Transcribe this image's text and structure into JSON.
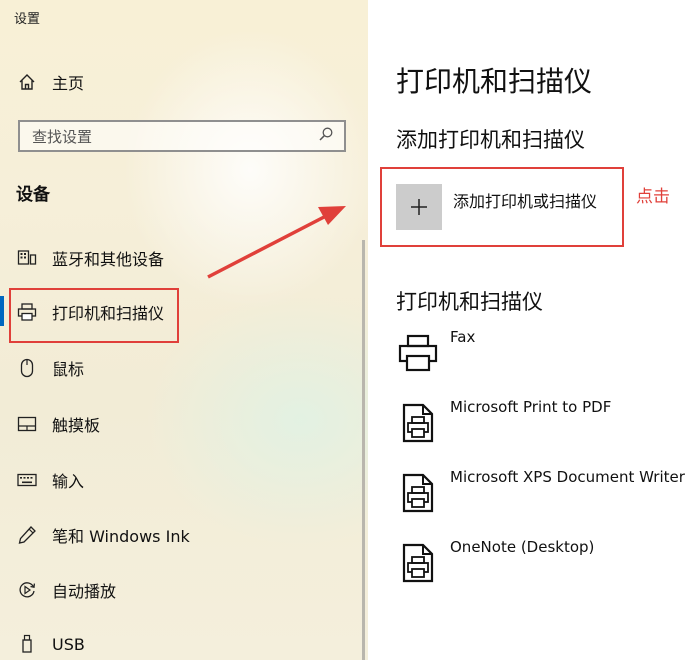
{
  "window": {
    "title": "设置"
  },
  "sidebar": {
    "home_label": "主页",
    "search_placeholder": "查找设置",
    "section_label": "设备",
    "items": [
      {
        "label": "蓝牙和其他设备",
        "icon": "bluetooth-devices-icon"
      },
      {
        "label": "打印机和扫描仪",
        "icon": "printer-icon",
        "selected": true
      },
      {
        "label": "鼠标",
        "icon": "mouse-icon"
      },
      {
        "label": "触摸板",
        "icon": "touchpad-icon"
      },
      {
        "label": "输入",
        "icon": "keyboard-icon"
      },
      {
        "label": "笔和 Windows Ink",
        "icon": "pen-icon"
      },
      {
        "label": "自动播放",
        "icon": "autoplay-icon"
      },
      {
        "label": "USB",
        "icon": "usb-icon"
      }
    ]
  },
  "main": {
    "page_title": "打印机和扫描仪",
    "add_section_title": "添加打印机和扫描仪",
    "add_button_label": "添加打印机或扫描仪",
    "list_section_title": "打印机和扫描仪",
    "printers": [
      {
        "name": "Fax",
        "icon": "fax-printer-icon"
      },
      {
        "name": "Microsoft Print to PDF",
        "icon": "document-printer-icon"
      },
      {
        "name": "Microsoft XPS Document Writer",
        "icon": "document-printer-icon"
      },
      {
        "name": "OneNote (Desktop)",
        "icon": "document-printer-icon"
      }
    ]
  },
  "annotation": {
    "label": "点击",
    "color": "#e0403a"
  },
  "colors": {
    "accent": "#0067c0",
    "highlight": "#e0403a",
    "tile": "#cccccc"
  }
}
